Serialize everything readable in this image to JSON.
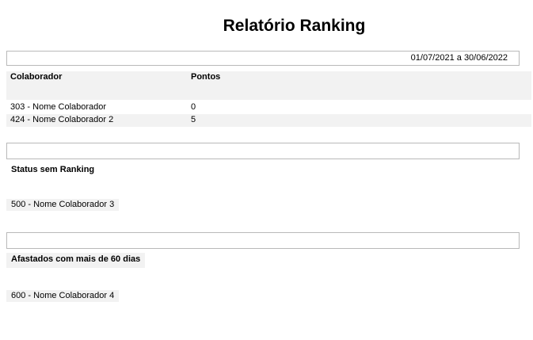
{
  "report": {
    "title": "Relatório Ranking",
    "date_range": "01/07/2021 a 30/06/2022"
  },
  "ranking_table": {
    "headers": {
      "collaborator": "Colaborador",
      "points": "Pontos"
    },
    "rows": [
      {
        "collaborator": "303 - Nome Colaborador",
        "points": "0"
      },
      {
        "collaborator": "424 - Nome Colaborador 2",
        "points": "5"
      }
    ]
  },
  "status_without_ranking": {
    "label": "Status sem Ranking",
    "items": [
      "500 - Nome Colaborador 3"
    ]
  },
  "away_over_60_days": {
    "label": "Afastados com mais de 60 dias",
    "items": [
      "600 - Nome Colaborador 4"
    ]
  }
}
